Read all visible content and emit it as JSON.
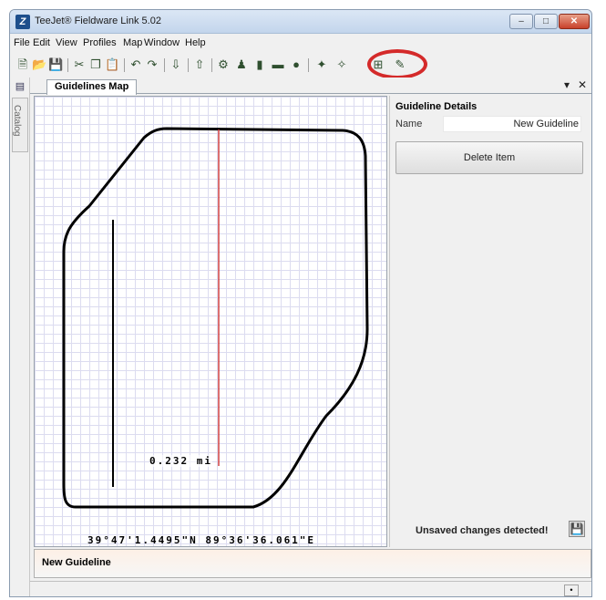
{
  "window": {
    "title": "TeeJet® Fieldware Link 5.02",
    "app_icon": "Z",
    "controls": {
      "minimize": "–",
      "maximize": "□",
      "close": "✕"
    }
  },
  "menu": [
    "File",
    "Edit",
    "View",
    "Profiles",
    "Map",
    "Window",
    "Help"
  ],
  "toolbar": {
    "icons": [
      {
        "name": "new-icon",
        "glyph": "🗎"
      },
      {
        "name": "open-icon",
        "glyph": "📂"
      },
      {
        "name": "save-icon",
        "glyph": "💾"
      },
      {
        "name": "cut-icon",
        "glyph": "✂"
      },
      {
        "name": "copy-icon",
        "glyph": "❐"
      },
      {
        "name": "paste-icon",
        "glyph": "📋"
      },
      {
        "name": "undo-icon",
        "glyph": "↶"
      },
      {
        "name": "redo-icon",
        "glyph": "↷"
      },
      {
        "name": "import-icon",
        "glyph": "⇩"
      },
      {
        "name": "export-icon",
        "glyph": "⇧"
      },
      {
        "name": "machine-icon",
        "glyph": "⚙"
      },
      {
        "name": "operator-icon",
        "glyph": "♟"
      },
      {
        "name": "chart-icon",
        "glyph": "▮"
      },
      {
        "name": "field-icon",
        "glyph": "▬"
      },
      {
        "name": "info-icon",
        "glyph": "●"
      },
      {
        "name": "marker-icon",
        "glyph": "✦"
      },
      {
        "name": "guideline-icon",
        "glyph": "✧"
      },
      {
        "name": "guideline-tool-icon",
        "glyph": "⊞"
      },
      {
        "name": "measure-icon",
        "glyph": "✎"
      }
    ]
  },
  "side": {
    "button": "▤",
    "catalog_label": "Catalog"
  },
  "tabs": {
    "active": "Guidelines Map",
    "dropdown": "▾",
    "close": "✕"
  },
  "map": {
    "distance_label": "0.232 mi",
    "coordinates": "39°47'1.4495\"N 89°36'36.061\"E",
    "boundary_color": "#000000",
    "guideline_color": "#d04040",
    "grid_color": "#dcdcf0"
  },
  "details": {
    "title": "Guideline Details",
    "name_label": "Name",
    "name_value": "New Guideline",
    "delete_button": "Delete Item",
    "unsaved_text": "Unsaved changes detected!",
    "save_glyph": "💾"
  },
  "bottom": {
    "tab_label": "New Guideline"
  },
  "status": {
    "cell": "•"
  }
}
